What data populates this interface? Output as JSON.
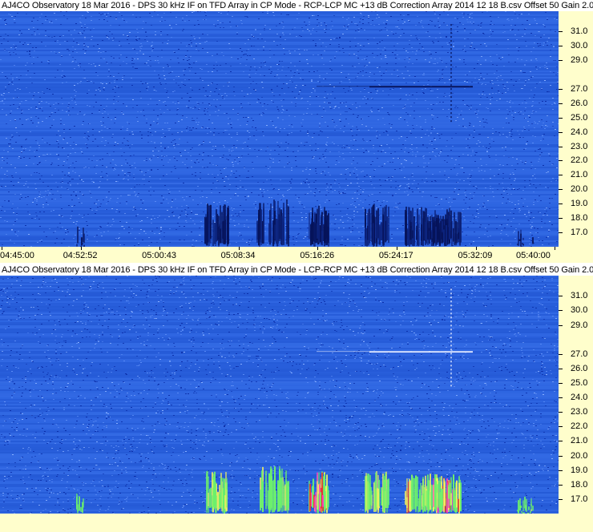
{
  "chart_data": [
    {
      "type": "heatmap",
      "title": "AJ4CO Observatory 18 Mar 2016 - DPS 30 kHz IF on TFD Array in CP Mode - RCP-LCP  MC +13 dB  Correction Array 2014 12 18 B.csv   Offset 50   Gain 2.0",
      "y_unit": "MHz",
      "y_ticks": [
        "31.0",
        "30.0",
        "29.0",
        "27.0",
        "26.0",
        "25.0",
        "24.0",
        "23.0",
        "22.0",
        "21.0",
        "20.0",
        "19.0",
        "18.0",
        "17.0"
      ],
      "y_tick_values": [
        31.0,
        30.0,
        29.0,
        27.0,
        26.0,
        25.0,
        24.0,
        23.0,
        22.0,
        21.0,
        20.0,
        19.0,
        18.0,
        17.0
      ],
      "ylim": [
        16.0,
        32.4
      ],
      "x_ticks": [
        "04:45:00",
        "04:52:52",
        "05:00:43",
        "05:08:34",
        "05:16:26",
        "05:24:17",
        "05:32:09",
        "05:40:00"
      ],
      "x_tick_seconds_since_04_45_00": [
        0,
        472,
        943,
        1414,
        1886,
        2357,
        2829,
        3300
      ],
      "colormap": "blue background, dark navy for negative polarization",
      "palette": {
        "background": "#2a62e0",
        "dark": "#06135a",
        "light": "#5a8cf0"
      }
    },
    {
      "type": "heatmap",
      "title": "AJ4CO Observatory 18 Mar 2016 - DPS 30 kHz IF on TFD Array in CP Mode - LCP-RCP  MC +13 dB  Correction Array 2014 12 18 B.csv   Offset 50   Gain 2.0",
      "y_unit": "MHz",
      "y_ticks": [
        "31.0",
        "30.0",
        "29.0",
        "27.0",
        "26.0",
        "25.0",
        "24.0",
        "23.0",
        "22.0",
        "21.0",
        "20.0",
        "19.0",
        "18.0",
        "17.0"
      ],
      "y_tick_values": [
        31.0,
        30.0,
        29.0,
        27.0,
        26.0,
        25.0,
        24.0,
        23.0,
        22.0,
        21.0,
        20.0,
        19.0,
        18.0,
        17.0
      ],
      "ylim": [
        16.0,
        32.4
      ],
      "x_ticks": [],
      "colormap": "blue background, green-yellow-red-magenta for positive polarization",
      "palette": {
        "background": "#2a62e0",
        "green": "#6cf06c",
        "yellow": "#f0f060",
        "red": "#e83030",
        "magenta": "#ff40c0"
      }
    }
  ],
  "frame": {
    "axis_bg": "#fffecc"
  }
}
